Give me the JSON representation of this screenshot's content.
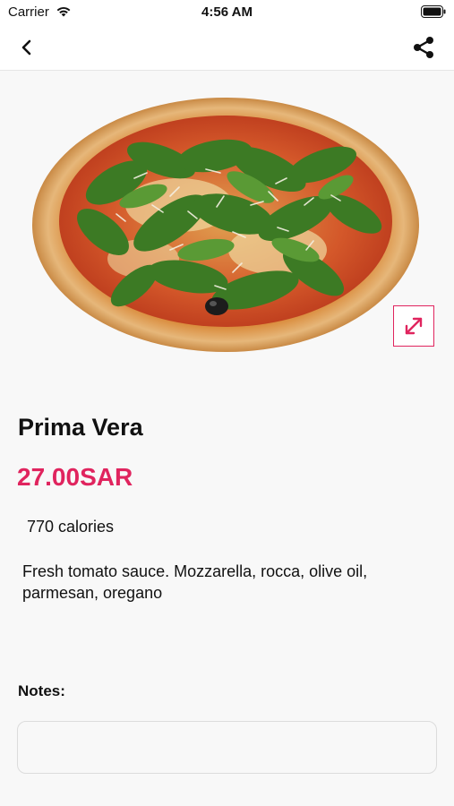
{
  "status_bar": {
    "carrier": "Carrier",
    "time": "4:56 AM"
  },
  "nav": {
    "back_icon": "chevron-left-icon",
    "share_icon": "share-icon"
  },
  "product": {
    "name": "Prima Vera",
    "price": "27.00SAR",
    "calories": "770 calories",
    "description": "Fresh tomato sauce. Mozzarella, rocca, olive oil, parmesan, oregano",
    "image_alt": "pizza-image",
    "expand_icon": "expand-arrows-icon"
  },
  "notes": {
    "label": "Notes:",
    "value": "",
    "placeholder": ""
  },
  "colors": {
    "accent": "#e0245e",
    "background": "#f8f8f8"
  }
}
